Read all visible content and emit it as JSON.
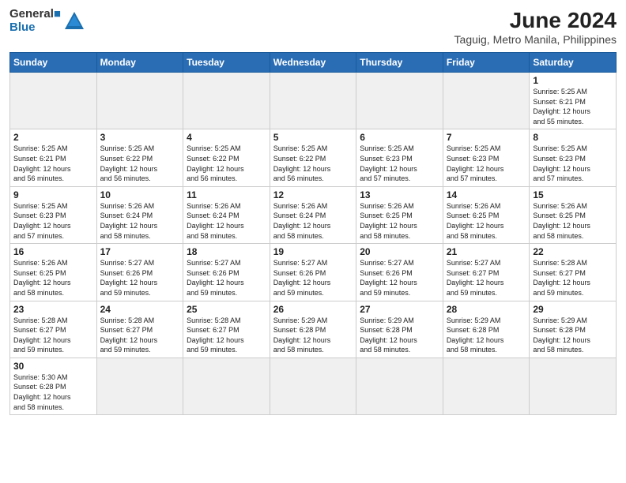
{
  "logo": {
    "line1": "General",
    "line2": "Blue"
  },
  "title": "June 2024",
  "subtitle": "Taguig, Metro Manila, Philippines",
  "days_header": [
    "Sunday",
    "Monday",
    "Tuesday",
    "Wednesday",
    "Thursday",
    "Friday",
    "Saturday"
  ],
  "weeks": [
    [
      {
        "num": "",
        "info": ""
      },
      {
        "num": "",
        "info": ""
      },
      {
        "num": "",
        "info": ""
      },
      {
        "num": "",
        "info": ""
      },
      {
        "num": "",
        "info": ""
      },
      {
        "num": "",
        "info": ""
      },
      {
        "num": "1",
        "info": "Sunrise: 5:25 AM\nSunset: 6:21 PM\nDaylight: 12 hours\nand 55 minutes."
      }
    ],
    [
      {
        "num": "2",
        "info": "Sunrise: 5:25 AM\nSunset: 6:21 PM\nDaylight: 12 hours\nand 56 minutes."
      },
      {
        "num": "3",
        "info": "Sunrise: 5:25 AM\nSunset: 6:22 PM\nDaylight: 12 hours\nand 56 minutes."
      },
      {
        "num": "4",
        "info": "Sunrise: 5:25 AM\nSunset: 6:22 PM\nDaylight: 12 hours\nand 56 minutes."
      },
      {
        "num": "5",
        "info": "Sunrise: 5:25 AM\nSunset: 6:22 PM\nDaylight: 12 hours\nand 56 minutes."
      },
      {
        "num": "6",
        "info": "Sunrise: 5:25 AM\nSunset: 6:23 PM\nDaylight: 12 hours\nand 57 minutes."
      },
      {
        "num": "7",
        "info": "Sunrise: 5:25 AM\nSunset: 6:23 PM\nDaylight: 12 hours\nand 57 minutes."
      },
      {
        "num": "8",
        "info": "Sunrise: 5:25 AM\nSunset: 6:23 PM\nDaylight: 12 hours\nand 57 minutes."
      }
    ],
    [
      {
        "num": "9",
        "info": "Sunrise: 5:25 AM\nSunset: 6:23 PM\nDaylight: 12 hours\nand 57 minutes."
      },
      {
        "num": "10",
        "info": "Sunrise: 5:26 AM\nSunset: 6:24 PM\nDaylight: 12 hours\nand 58 minutes."
      },
      {
        "num": "11",
        "info": "Sunrise: 5:26 AM\nSunset: 6:24 PM\nDaylight: 12 hours\nand 58 minutes."
      },
      {
        "num": "12",
        "info": "Sunrise: 5:26 AM\nSunset: 6:24 PM\nDaylight: 12 hours\nand 58 minutes."
      },
      {
        "num": "13",
        "info": "Sunrise: 5:26 AM\nSunset: 6:25 PM\nDaylight: 12 hours\nand 58 minutes."
      },
      {
        "num": "14",
        "info": "Sunrise: 5:26 AM\nSunset: 6:25 PM\nDaylight: 12 hours\nand 58 minutes."
      },
      {
        "num": "15",
        "info": "Sunrise: 5:26 AM\nSunset: 6:25 PM\nDaylight: 12 hours\nand 58 minutes."
      }
    ],
    [
      {
        "num": "16",
        "info": "Sunrise: 5:26 AM\nSunset: 6:25 PM\nDaylight: 12 hours\nand 58 minutes."
      },
      {
        "num": "17",
        "info": "Sunrise: 5:27 AM\nSunset: 6:26 PM\nDaylight: 12 hours\nand 59 minutes."
      },
      {
        "num": "18",
        "info": "Sunrise: 5:27 AM\nSunset: 6:26 PM\nDaylight: 12 hours\nand 59 minutes."
      },
      {
        "num": "19",
        "info": "Sunrise: 5:27 AM\nSunset: 6:26 PM\nDaylight: 12 hours\nand 59 minutes."
      },
      {
        "num": "20",
        "info": "Sunrise: 5:27 AM\nSunset: 6:26 PM\nDaylight: 12 hours\nand 59 minutes."
      },
      {
        "num": "21",
        "info": "Sunrise: 5:27 AM\nSunset: 6:27 PM\nDaylight: 12 hours\nand 59 minutes."
      },
      {
        "num": "22",
        "info": "Sunrise: 5:28 AM\nSunset: 6:27 PM\nDaylight: 12 hours\nand 59 minutes."
      }
    ],
    [
      {
        "num": "23",
        "info": "Sunrise: 5:28 AM\nSunset: 6:27 PM\nDaylight: 12 hours\nand 59 minutes."
      },
      {
        "num": "24",
        "info": "Sunrise: 5:28 AM\nSunset: 6:27 PM\nDaylight: 12 hours\nand 59 minutes."
      },
      {
        "num": "25",
        "info": "Sunrise: 5:28 AM\nSunset: 6:27 PM\nDaylight: 12 hours\nand 59 minutes."
      },
      {
        "num": "26",
        "info": "Sunrise: 5:29 AM\nSunset: 6:28 PM\nDaylight: 12 hours\nand 58 minutes."
      },
      {
        "num": "27",
        "info": "Sunrise: 5:29 AM\nSunset: 6:28 PM\nDaylight: 12 hours\nand 58 minutes."
      },
      {
        "num": "28",
        "info": "Sunrise: 5:29 AM\nSunset: 6:28 PM\nDaylight: 12 hours\nand 58 minutes."
      },
      {
        "num": "29",
        "info": "Sunrise: 5:29 AM\nSunset: 6:28 PM\nDaylight: 12 hours\nand 58 minutes."
      }
    ],
    [
      {
        "num": "30",
        "info": "Sunrise: 5:30 AM\nSunset: 6:28 PM\nDaylight: 12 hours\nand 58 minutes."
      },
      {
        "num": "",
        "info": ""
      },
      {
        "num": "",
        "info": ""
      },
      {
        "num": "",
        "info": ""
      },
      {
        "num": "",
        "info": ""
      },
      {
        "num": "",
        "info": ""
      },
      {
        "num": "",
        "info": ""
      }
    ]
  ]
}
